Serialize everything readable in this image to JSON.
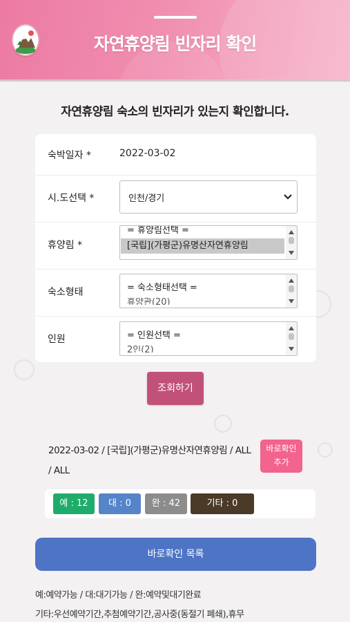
{
  "header": {
    "title": "자연휴양림 빈자리 확인"
  },
  "intro": "자연휴양림 숙소의 빈자리가 있는지 확인합니다.",
  "form": {
    "date": {
      "label": "숙박일자 *",
      "value": "2022-03-02"
    },
    "region": {
      "label": "시.도선택 *",
      "selected": "인천/경기"
    },
    "forest": {
      "label": "휴양림 *",
      "options": [
        "= 휴양림선택 =",
        "[국립](가평군)유명산자연휴양림"
      ],
      "selected_index": 1
    },
    "lodging": {
      "label": "숙소형태",
      "options": [
        "= 숙소형태선택 =",
        "휴양관(20)"
      ]
    },
    "people": {
      "label": "인원",
      "options": [
        "= 인원선택 =",
        "2인(2)"
      ]
    }
  },
  "search_button": "조회하기",
  "result": {
    "line1": "2022-03-02 / [국립](가평군)유명산자연휴양림 / ALL",
    "line2": "/ ALL",
    "add_button_line1": "바로확인",
    "add_button_line2": "추가"
  },
  "status": {
    "available": "예 : 12",
    "waiting": "대 : 0",
    "complete": "완 : 42",
    "other": "기타 : 0",
    "colors": {
      "available": "#1fac6b",
      "waiting": "#5684c8",
      "complete": "#8c8c8c",
      "other": "#4b3a28"
    }
  },
  "list_button": "바로확인 목록",
  "legend": {
    "line1": "예:예약가능 / 대:대기가능 / 완:예약및대기완료",
    "line2": "기타:우선예약기간,추첨예약기간,공사중(동절기 폐쇄),휴무"
  },
  "icons": {
    "logo": "forest-logo-icon",
    "select_arrow": "chevron-down-icon"
  }
}
